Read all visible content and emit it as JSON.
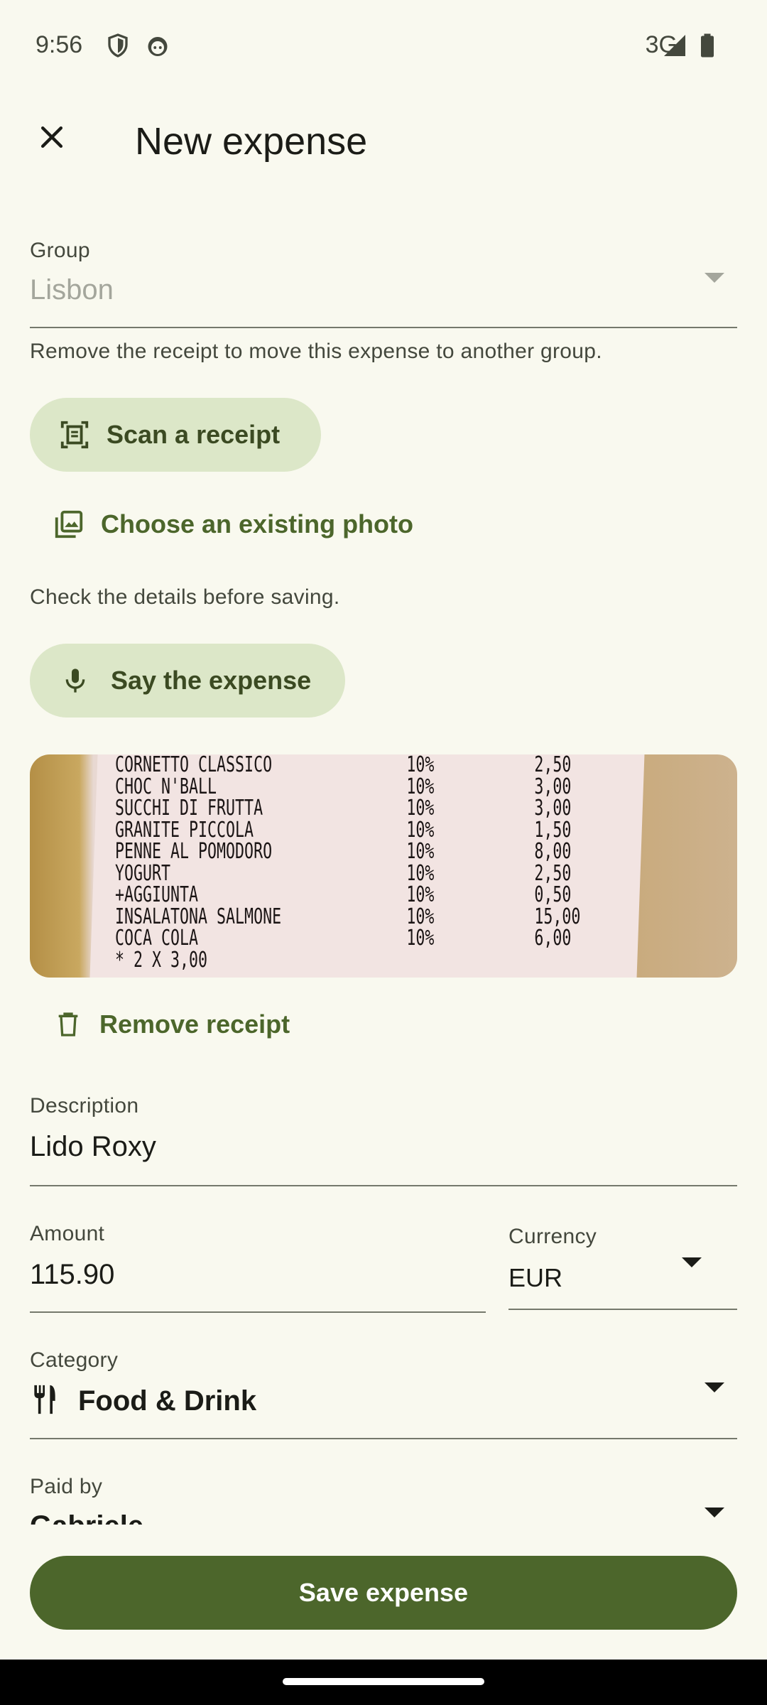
{
  "status_bar": {
    "time": "9:56",
    "network": "3G",
    "icons": [
      "shield-icon",
      "android-icon",
      "signal-icon",
      "battery-icon"
    ]
  },
  "app_bar": {
    "title": "New expense",
    "close_icon": "close-icon"
  },
  "group": {
    "label": "Group",
    "value": "Lisbon",
    "helper": "Remove the receipt to move this expense to another group."
  },
  "actions": {
    "scan_receipt": "Scan a receipt",
    "choose_photo": "Choose an existing photo",
    "check_details": "Check the details before saving.",
    "say_expense": "Say the expense",
    "remove_receipt": "Remove receipt"
  },
  "receipt_lines": [
    {
      "item": "CORNETTO CLASSICO",
      "vat": "10%",
      "price": "2,50"
    },
    {
      "item": "CHOC N'BALL",
      "vat": "10%",
      "price": "3,00"
    },
    {
      "item": "SUCCHI DI FRUTTA",
      "vat": "10%",
      "price": "3,00"
    },
    {
      "item": "GRANITE PICCOLA",
      "vat": "10%",
      "price": "1,50"
    },
    {
      "item": "PENNE AL POMODORO",
      "vat": "10%",
      "price": "8,00"
    },
    {
      "item": "YOGURT",
      "vat": "10%",
      "price": "2,50"
    },
    {
      "item": "+AGGIUNTA",
      "vat": "10%",
      "price": "0,50"
    },
    {
      "item": "INSALATONA SALMONE",
      "vat": "10%",
      "price": "15,00"
    },
    {
      "item": "COCA COLA",
      "vat": "10%",
      "price": "6,00"
    },
    {
      "item": "* 2 X 3,00",
      "vat": "",
      "price": ""
    }
  ],
  "description": {
    "label": "Description",
    "value": "Lido Roxy"
  },
  "amount": {
    "label": "Amount",
    "value": "115.90"
  },
  "currency": {
    "label": "Currency",
    "value": "EUR"
  },
  "category": {
    "label": "Category",
    "value": "Food & Drink",
    "icon": "fork-knife-icon"
  },
  "paid_by": {
    "label": "Paid by",
    "value": "Gabriele"
  },
  "save_button": "Save expense",
  "colors": {
    "background": "#f9f9ef",
    "primary": "#4c662b",
    "tonal": "#dce7c8"
  }
}
